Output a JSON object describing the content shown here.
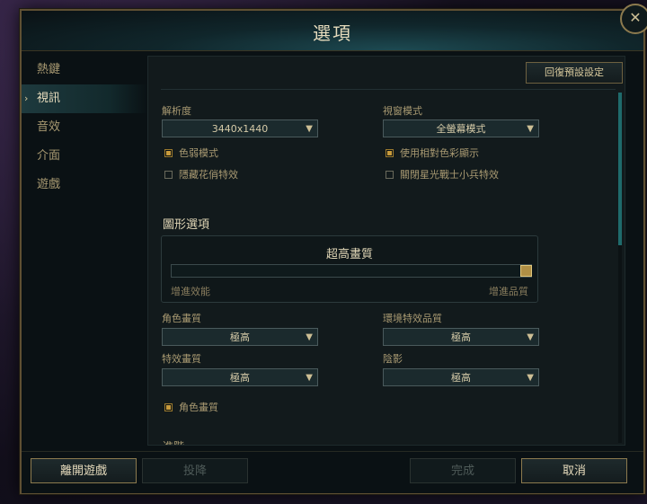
{
  "window": {
    "title": "選項",
    "close_glyph": "✕"
  },
  "sidebar": {
    "active_marker": "›",
    "items": [
      {
        "label": "熱鍵"
      },
      {
        "label": "視訊"
      },
      {
        "label": "音效"
      },
      {
        "label": "介面"
      },
      {
        "label": "遊戲"
      }
    ]
  },
  "content": {
    "reset_label": "回復預設設定",
    "resolution": {
      "label": "解析度",
      "value": "3440x1440"
    },
    "window_mode": {
      "label": "視窗模式",
      "value": "全螢幕模式"
    },
    "colorblind": {
      "label": "色弱模式",
      "checked": true
    },
    "relative_color": {
      "label": "使用相對色彩顯示",
      "checked": true
    },
    "hide_eye_candy": {
      "label": "隱藏花俏特效",
      "checked": false
    },
    "disable_star_guardian": {
      "label": "關閉星光戰士小兵特效",
      "checked": false
    },
    "graphics_section_title": "圖形選項",
    "graphics": {
      "level_label": "超高畫質",
      "slider_value": 1.0,
      "left_label": "增進效能",
      "right_label": "增進品質"
    },
    "character_quality": {
      "label": "角色畫質",
      "value": "極高"
    },
    "environment_quality": {
      "label": "環境特效品質",
      "value": "極高"
    },
    "effects_quality": {
      "label": "特效畫質",
      "value": "極高"
    },
    "shadows": {
      "label": "陰影",
      "value": "極高"
    },
    "character_inking": {
      "label": "角色畫質",
      "checked": true
    },
    "advanced_title": "進階",
    "caret": "▼"
  },
  "footer": {
    "quit_label": "離開遊戲",
    "surrender_label": "投降",
    "done_label": "完成",
    "cancel_label": "取消"
  },
  "colors": {
    "accent_gold": "#c89b3c",
    "scroll_teal": "#1f6b6c",
    "panel_bg": "#121a1c"
  }
}
